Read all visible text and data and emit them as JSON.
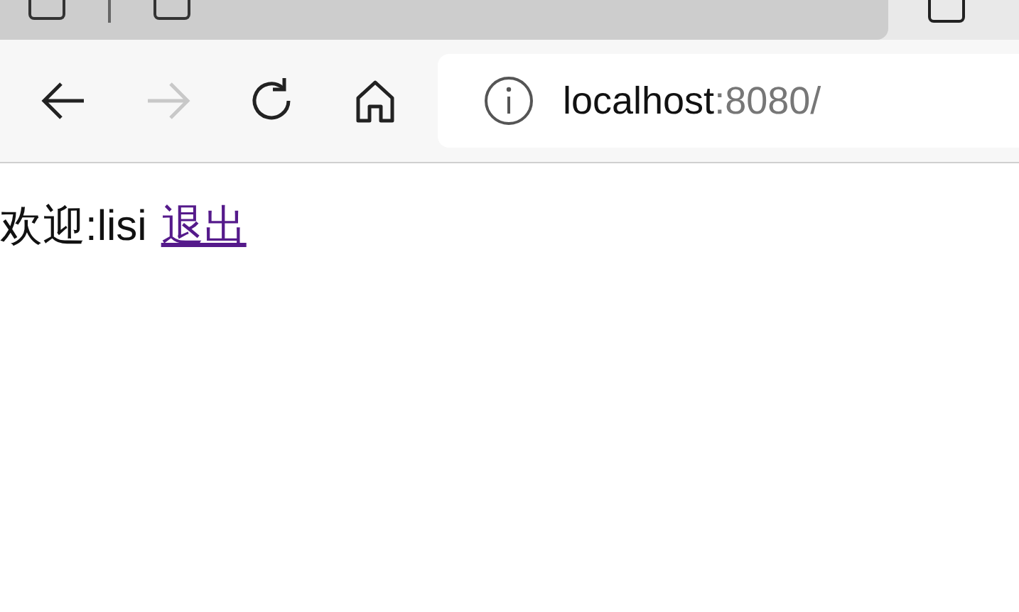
{
  "browser": {
    "address": {
      "host": "localhost",
      "rest": ":8080/"
    },
    "forward_disabled": true
  },
  "page": {
    "greeting": "欢迎:lisi",
    "logout_link": "退出"
  }
}
